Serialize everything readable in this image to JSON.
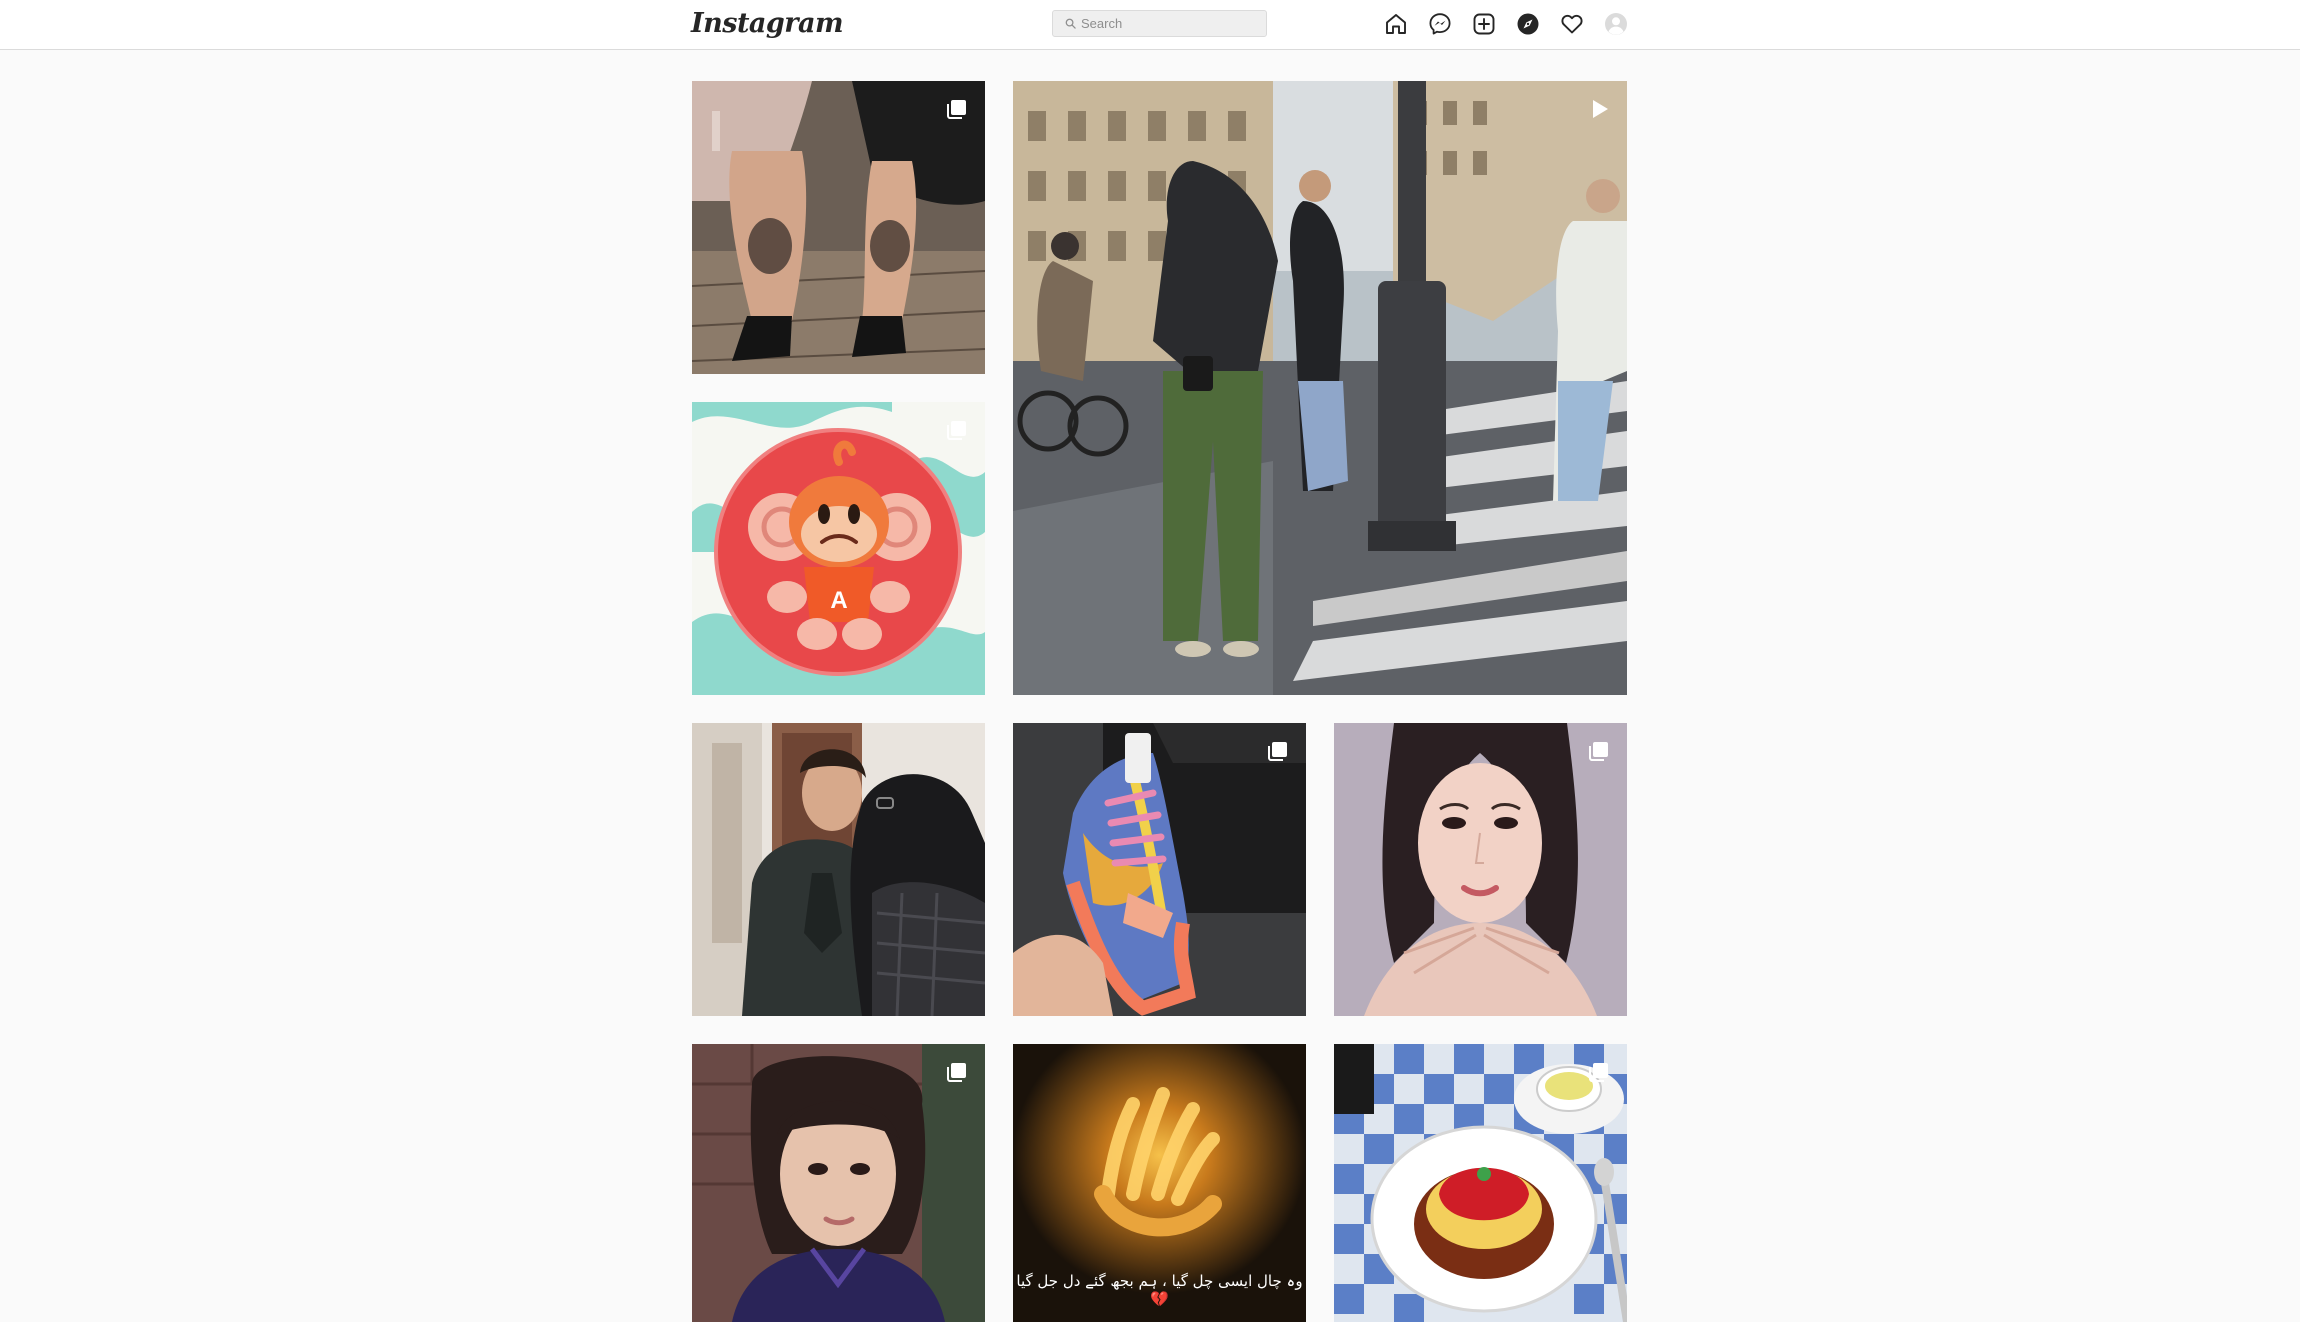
{
  "header": {
    "logo_text": "Instagram",
    "search_placeholder": "Search",
    "search_value": "",
    "nav_icons": [
      "home-icon",
      "messenger-icon",
      "new-post-icon",
      "explore-icon",
      "activity-heart-icon",
      "profile-avatar-icon"
    ]
  },
  "grid": {
    "posts": [
      {
        "subject": "two people showing anime knee tattoos",
        "badge": "carousel-icon"
      },
      {
        "subject": "Paris street photo shoot",
        "badge": "reel-icon"
      },
      {
        "subject": "orange monkey mascot on red circle",
        "badge": "carousel-icon"
      },
      {
        "subject": "two men talking",
        "badge": "none"
      },
      {
        "subject": "colorful sneaker in hand",
        "badge": "carousel-icon"
      },
      {
        "subject": "portrait of woman with hands",
        "badge": "carousel-icon"
      },
      {
        "subject": "portrait of woman with bangs",
        "badge": "carousel-icon"
      },
      {
        "subject": "glowing hand in dark",
        "badge": "none",
        "caption": "وہ چال ایسی چل گیا ، ہم بجھ گئے دل جل گیا 💔"
      },
      {
        "subject": "omurice on plate with tea",
        "badge": "carousel-icon"
      }
    ]
  },
  "colors": {
    "background": "#fafafa",
    "header_bg": "#ffffff",
    "border": "#dbdbdb",
    "icon": "#262626"
  }
}
